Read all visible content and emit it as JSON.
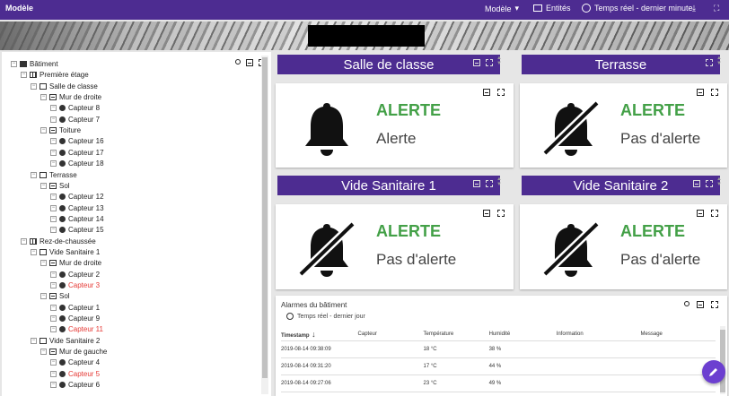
{
  "topbar": {
    "title": "Modèle",
    "model_select": "Modèle",
    "entities": "Entités",
    "time": "Temps réel - dernier minute"
  },
  "tree": [
    {
      "label": "Bâtiment",
      "icon": "building-icon",
      "level": 0,
      "red": false
    },
    {
      "label": "Première étage",
      "icon": "floor-icon",
      "level": 1,
      "red": false
    },
    {
      "label": "Salle de classe",
      "icon": "room-icon",
      "level": 2,
      "red": false
    },
    {
      "label": "Mur de droite",
      "icon": "wall-icon",
      "level": 3,
      "red": false
    },
    {
      "label": "Capteur 8",
      "icon": "sensor-icon",
      "level": 4,
      "red": false
    },
    {
      "label": "Capteur 7",
      "icon": "sensor-icon",
      "level": 4,
      "red": false
    },
    {
      "label": "Toiture",
      "icon": "wall-icon",
      "level": 3,
      "red": false
    },
    {
      "label": "Capteur 16",
      "icon": "sensor-icon",
      "level": 4,
      "red": false
    },
    {
      "label": "Capteur 17",
      "icon": "sensor-icon",
      "level": 4,
      "red": false
    },
    {
      "label": "Capteur 18",
      "icon": "sensor-icon",
      "level": 4,
      "red": false
    },
    {
      "label": "Terrasse",
      "icon": "room-icon",
      "level": 2,
      "red": false
    },
    {
      "label": "Sol",
      "icon": "wall-icon",
      "level": 3,
      "red": false
    },
    {
      "label": "Capteur 12",
      "icon": "sensor-icon",
      "level": 4,
      "red": false
    },
    {
      "label": "Capteur 13",
      "icon": "sensor-icon",
      "level": 4,
      "red": false
    },
    {
      "label": "Capteur 14",
      "icon": "sensor-icon",
      "level": 4,
      "red": false
    },
    {
      "label": "Capteur 15",
      "icon": "sensor-icon",
      "level": 4,
      "red": false
    },
    {
      "label": "Rez-de-chaussée",
      "icon": "floor-icon",
      "level": 1,
      "red": false
    },
    {
      "label": "Vide Sanitaire 1",
      "icon": "room-icon",
      "level": 2,
      "red": false
    },
    {
      "label": "Mur de droite",
      "icon": "wall-icon",
      "level": 3,
      "red": false
    },
    {
      "label": "Capteur 2",
      "icon": "sensor-icon",
      "level": 4,
      "red": false
    },
    {
      "label": "Capteur 3",
      "icon": "sensor-icon",
      "level": 4,
      "red": true
    },
    {
      "label": "Sol",
      "icon": "wall-icon",
      "level": 3,
      "red": false
    },
    {
      "label": "Capteur 1",
      "icon": "sensor-icon",
      "level": 4,
      "red": false
    },
    {
      "label": "Capteur 9",
      "icon": "sensor-icon",
      "level": 4,
      "red": false
    },
    {
      "label": "Capteur 11",
      "icon": "sensor-icon",
      "level": 4,
      "red": true
    },
    {
      "label": "Vide Sanitaire 2",
      "icon": "room-icon",
      "level": 2,
      "red": false
    },
    {
      "label": "Mur de gauche",
      "icon": "wall-icon",
      "level": 3,
      "red": false
    },
    {
      "label": "Capteur 4",
      "icon": "sensor-icon",
      "level": 4,
      "red": false
    },
    {
      "label": "Capteur 5",
      "icon": "sensor-icon",
      "level": 4,
      "red": true
    },
    {
      "label": "Capteur 6",
      "icon": "sensor-icon",
      "level": 4,
      "red": false
    }
  ],
  "rooms": [
    {
      "name": "Salle de classe",
      "alert_title": "ALERTE",
      "status": "Alerte",
      "alert": true
    },
    {
      "name": "Terrasse",
      "alert_title": "ALERTE",
      "status": "Pas d'alerte",
      "alert": false
    },
    {
      "name": "Vide Sanitaire 1",
      "alert_title": "ALERTE",
      "status": "Pas d'alerte",
      "alert": false
    },
    {
      "name": "Vide Sanitaire 2",
      "alert_title": "ALERTE",
      "status": "Pas d'alerte",
      "alert": false
    }
  ],
  "alarms": {
    "title": "Alarmes du bâtiment",
    "time": "Temps réel - dernier jour",
    "columns": [
      "Timestamp",
      "Capteur",
      "Température",
      "Humidité",
      "Information",
      "Message"
    ],
    "rows": [
      [
        "2019-08-14 09:38:09",
        "",
        "18 °C",
        "38 %",
        "",
        ""
      ],
      [
        "2019-08-14 09:31:20",
        "",
        "17 °C",
        "44 %",
        "",
        ""
      ],
      [
        "2019-08-14 09:27:06",
        "",
        "23 °C",
        "49 %",
        "",
        ""
      ]
    ]
  },
  "colors": {
    "primary": "#4d2c91",
    "alert_green": "#43a047",
    "alarm_red": "#e53935",
    "fab": "#6c3fd0"
  }
}
